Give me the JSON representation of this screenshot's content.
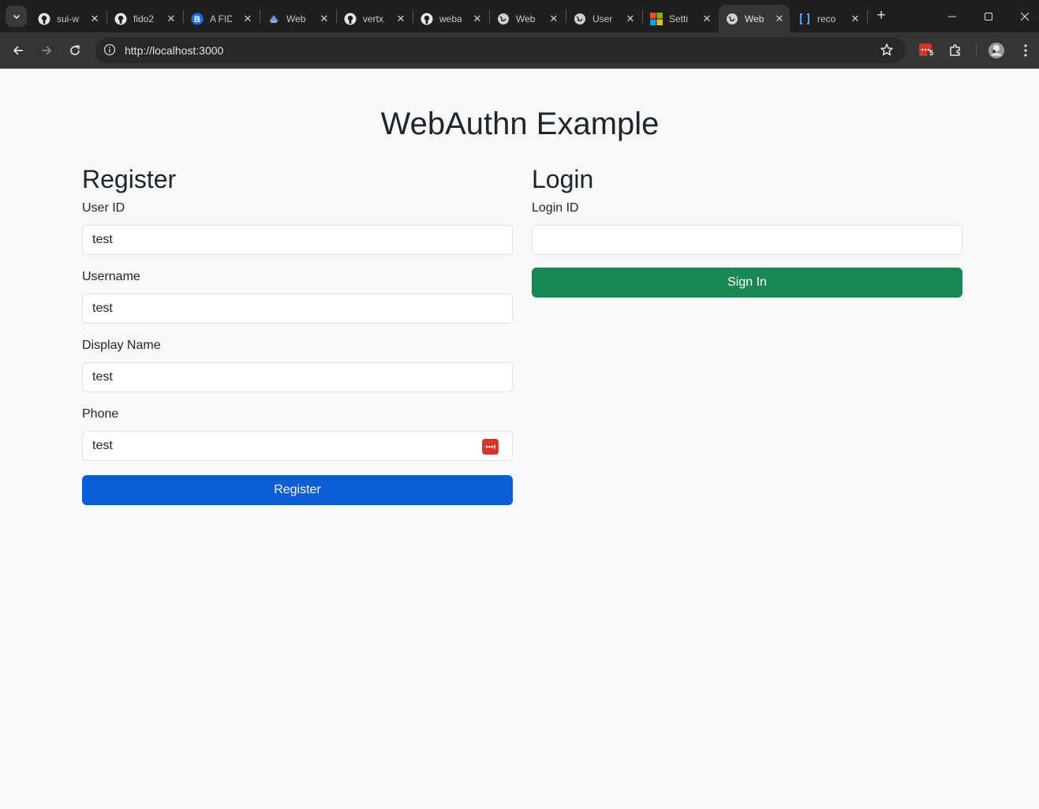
{
  "browser": {
    "tabs": [
      {
        "title": "sui-w",
        "icon": "github-icon"
      },
      {
        "title": "fido2",
        "icon": "github-icon"
      },
      {
        "title": "A FID",
        "icon": "b-logo-icon"
      },
      {
        "title": "Web",
        "icon": "webauthn-icon"
      },
      {
        "title": "vertx",
        "icon": "github-icon"
      },
      {
        "title": "weba",
        "icon": "github-icon"
      },
      {
        "title": "Web",
        "icon": "globe-icon"
      },
      {
        "title": "User",
        "icon": "globe-icon"
      },
      {
        "title": "Setti",
        "icon": "microsoft-icon"
      },
      {
        "title": "Web",
        "icon": "globe-icon",
        "active": true
      },
      {
        "title": "reco",
        "icon": "brackets-icon"
      }
    ],
    "url": "http://localhost:3000",
    "extension_badge": "5"
  },
  "page": {
    "title": "WebAuthn Example",
    "register": {
      "heading": "Register",
      "user_id_label": "User ID",
      "user_id_value": "test",
      "username_label": "Username",
      "username_value": "test",
      "display_name_label": "Display Name",
      "display_name_value": "test",
      "phone_label": "Phone",
      "phone_value": "test",
      "button_label": "Register"
    },
    "login": {
      "heading": "Login",
      "login_id_label": "Login ID",
      "login_id_value": "",
      "button_label": "Sign In"
    }
  },
  "colors": {
    "register_button": "#0b5ed7",
    "signin_button": "#198754",
    "password_manager_icon": "#d9342b"
  }
}
